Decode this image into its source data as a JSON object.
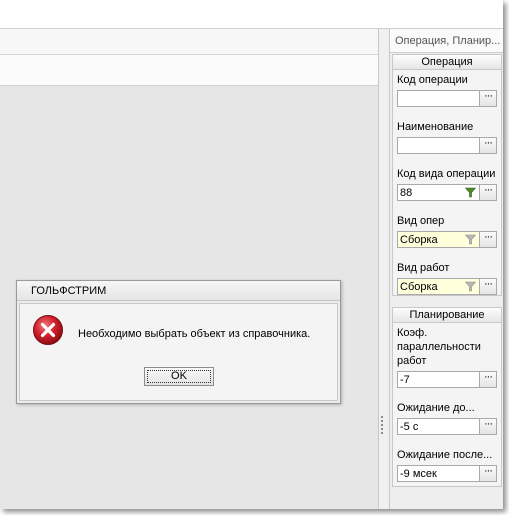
{
  "panel": {
    "title": "Операция, Планир...",
    "sections": {
      "operation": "Операция",
      "planning": "Планирование"
    },
    "fields": {
      "op_code": {
        "label": "Код операции",
        "value": ""
      },
      "name": {
        "label": "Наименование",
        "value": ""
      },
      "op_type_code": {
        "label": "Код вида операции",
        "value": "88"
      },
      "op_kind": {
        "label": "Вид опер",
        "value": "Сборка"
      },
      "work_kind": {
        "label": "Вид работ",
        "value": "Сборка"
      },
      "parallel_coef": {
        "label_line1": "Коэф.",
        "label_line2": "параллельности",
        "label_line3": "работ",
        "value": "-7"
      },
      "wait_before": {
        "label": "Ожидание до...",
        "value": "-5 с"
      },
      "wait_after": {
        "label": "Ожидание после...",
        "value": "-9 мсек"
      }
    },
    "ellipsis": "···"
  },
  "dialog": {
    "title": "ГОЛЬФСТРИМ",
    "message": "Необходимо выбрать объект из справочника.",
    "ok_label": "OK"
  },
  "colors": {
    "error_red": "#d0202a",
    "funnel_active": "#4a8a2a",
    "funnel_inactive": "#a0a0a0",
    "lookup_bg": "#ffffdc"
  },
  "icons": [
    "error-icon",
    "filter-icon",
    "ellipsis-icon"
  ]
}
